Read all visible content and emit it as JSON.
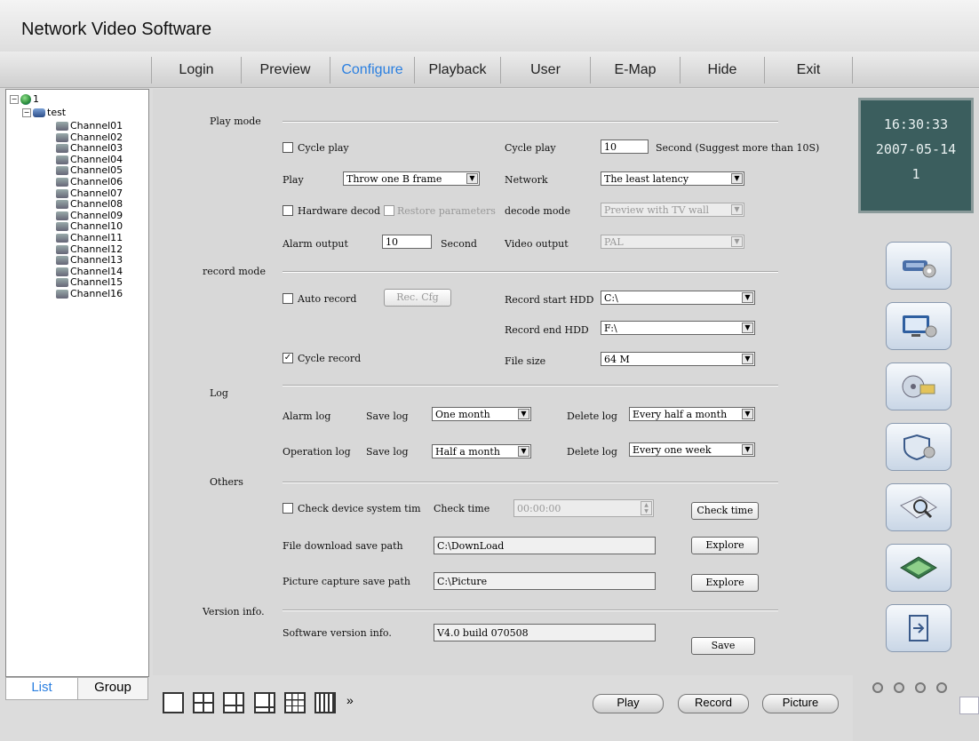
{
  "app": {
    "title": "Network Video Software"
  },
  "menu": [
    {
      "label": "Login"
    },
    {
      "label": "Preview"
    },
    {
      "label": "Configure"
    },
    {
      "label": "Playback"
    },
    {
      "label": "User"
    },
    {
      "label": "E-Map"
    },
    {
      "label": "Hide"
    },
    {
      "label": "Exit"
    }
  ],
  "tree": {
    "root": "1",
    "device": "test",
    "channels": [
      "Channel01",
      "Channel02",
      "Channel03",
      "Channel04",
      "Channel05",
      "Channel06",
      "Channel07",
      "Channel08",
      "Channel09",
      "Channel10",
      "Channel11",
      "Channel12",
      "Channel13",
      "Channel14",
      "Channel15",
      "Channel16"
    ]
  },
  "list_tabs": {
    "list": "List",
    "group": "Group"
  },
  "clock": {
    "time": "16:30:33",
    "date": "2007-05-14",
    "num": "1"
  },
  "config": {
    "play_mode": {
      "title": "Play mode",
      "cycle_play_chk": "Cycle play",
      "cycle_play_label": "Cycle play",
      "cycle_play_value": "10",
      "cycle_play_unit": "Second (Suggest more than 10S)",
      "play_label": "Play",
      "play_value": "Throw one B frame",
      "network_label": "Network",
      "network_value": "The least latency",
      "hw_decode_chk": "Hardware decod",
      "restore_chk": "Restore parameters",
      "decode_mode_label": "decode mode",
      "decode_mode_value": "Preview with TV wall",
      "alarm_output_label": "Alarm output",
      "alarm_output_value": "10",
      "alarm_output_unit": "Second",
      "video_output_label": "Video output",
      "video_output_value": "PAL"
    },
    "record_mode": {
      "title": "record mode",
      "auto_record_chk": "Auto record",
      "rec_cfg_btn": "Rec. Cfg",
      "start_hdd_label": "Record start HDD",
      "start_hdd_value": "C:\\",
      "end_hdd_label": "Record end HDD",
      "end_hdd_value": "F:\\",
      "cycle_record_chk": "Cycle record",
      "file_size_label": "File size",
      "file_size_value": "64 M"
    },
    "log": {
      "title": "Log",
      "alarm_log_label": "Alarm log",
      "alarm_save_label": "Save log",
      "alarm_save_value": "One month",
      "alarm_delete_label": "Delete log",
      "alarm_delete_value": "Every half a month",
      "op_log_label": "Operation log",
      "op_save_label": "Save log",
      "op_save_value": "Half a month",
      "op_delete_label": "Delete log",
      "op_delete_value": "Every one week"
    },
    "others": {
      "title": "Others",
      "check_time_chk": "Check device system tim",
      "check_time_label": "Check time",
      "check_time_value": "00:00:00",
      "check_time_btn": "Check time",
      "download_label": "File download save path",
      "download_value": "C:\\DownLoad",
      "explore_btn1": "Explore",
      "capture_label": "Picture capture save path",
      "capture_value": "C:\\Picture",
      "explore_btn2": "Explore"
    },
    "version": {
      "title": "Version info.",
      "software_label": "Software version info.",
      "software_value": "V4.0 build 070508",
      "save_btn": "Save"
    }
  },
  "bottom": {
    "more": "»",
    "play": "Play",
    "record": "Record",
    "picture": "Picture"
  }
}
